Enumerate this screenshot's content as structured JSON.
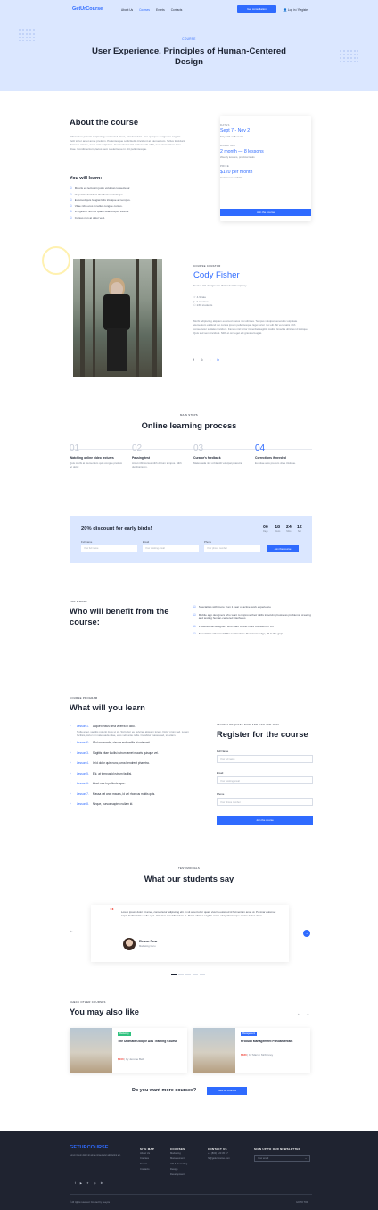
{
  "nav": {
    "logo": "GetUrCourse",
    "items": [
      "About Us",
      "Courses",
      "Events",
      "Contacts"
    ],
    "cta": "Get consultation",
    "login": "Log in / Register"
  },
  "hero": {
    "tag": "COURSE",
    "title": "User Experience. Principles of Human-Centered Design"
  },
  "about": {
    "title": "About the course",
    "text": "Vibrantium potenti adipiscing emanated sitaet, nisi tincidunt. Ima quisque congue in sagittis. Velit tortor amet amet pretium. Pellentesque sollicitudin tincidunt at elementum. Tellus tincidunt rhoncus ornare, ac id orci vulputate. Consectetur nisi malesuada nibh, sed elementum arcu vitae. Condimentum, lacus sem scelerisque in elit pellentesque.",
    "learn_title": "You will learn:",
    "learn": [
      "Mauris eu lectus in justo volutpat consectetur.",
      "Vulputate tincidunt tincidunt scelerisque.",
      "Euismod quis feugiat felis tristique ac tempus.",
      "Vitae nibh eros in tellus congue cursus.",
      "Fringilla in nisi vel quam ullamcorper viverra.",
      "Cursus non at dolor velit."
    ]
  },
  "card": {
    "dates_label": "DATES",
    "dates": "Sept 7 - Nov 2",
    "dates_text": "Stay with us 8 weeks",
    "duration_label": "DURATION",
    "duration": "2 month — 8 lessons",
    "duration_text": "Weekly lessons, practical tasks",
    "price_label": "PRICE",
    "price": "$120 per month",
    "price_text": "Installment available",
    "button": "Join the course"
  },
  "curator": {
    "eyebrow": "COURSE CURATOR",
    "name": "Cody Fisher",
    "role": "Senior UX designer in IT Product Company",
    "stats": [
      "4.9 rate",
      "4 courses",
      "230 students"
    ],
    "bio": "Morbi adipiscing aliquam euismod metus nisi ultricies. Tempus volutpat venenatis vulputate elementum eleifend dui cursus ipsum pellentesque. Eget tortor nec elit. Sit venenatis nibh consectetur sodales tincidunt. Fames nisl tortor imperdiet sagittis mattis. Gravida ultricies id tristique. Quis sed sem tincidunt. Nibh et orci eget elit gravida feugiat."
  },
  "steps": {
    "eyebrow": "MAIN STEPS",
    "title": "Online learning process",
    "items": [
      {
        "num": "01",
        "title": "Watching online video lectures",
        "text": "Quis morbi at elementum quis congue pretium ac dolor."
      },
      {
        "num": "02",
        "title": "Passing test",
        "text": "Amet nibh cursus nibh dictum tempus. Nibh dui dignissim."
      },
      {
        "num": "03",
        "title": "Curator's feedback",
        "text": "Malesuada nisl ut blandit volutpat pharetra."
      },
      {
        "num": "04",
        "title": "Corrections if needed",
        "text": "Eu vitae arcu pretium vitae tristique."
      }
    ]
  },
  "promo": {
    "title": "20% discount for early birds!",
    "countdown": [
      {
        "n": "06",
        "l": "Days"
      },
      {
        "n": "18",
        "l": "Hours"
      },
      {
        "n": "24",
        "l": "Mins"
      },
      {
        "n": "12",
        "l": "Sec"
      }
    ],
    "labels": [
      "Full name",
      "Email",
      "Phone"
    ],
    "placeholders": [
      "Your full name",
      "Your working email",
      "Your phone number"
    ],
    "button": "Join the course"
  },
  "benefit": {
    "eyebrow": "FOR WHOM?",
    "title": "Who will benefit from the course:",
    "items": [
      "Specialists with more than 1 year of active work experience",
      "Mobile app designers who want to improve their skills in solving business problems, creating and testing human-centered interfaces",
      "Professional designers who want to feel more confident in UX",
      "Specialists who would like to structure their knowledge, fill in the gaps"
    ]
  },
  "program": {
    "eyebrow": "COURSE PROGRAM",
    "title": "What will you learn",
    "lessons": [
      {
        "num": "Lesson 1.",
        "title": "Aliquet lectus urna viverra in odio."
      },
      {
        "num": "Lesson 2.",
        "title": "Orci commodo, viverra sed mollis ut euismod."
      },
      {
        "num": "Lesson 3.",
        "title": "Sagittis vitae facilisi rutrum amet mauris quisque vel."
      },
      {
        "num": "Lesson 4.",
        "title": "In id dolor quis nunc, urna hendrerit pharetra."
      },
      {
        "num": "Lesson 5.",
        "title": "Est, at tempus id rutrum facilisi."
      },
      {
        "num": "Lesson 6.",
        "title": "Amet nec in pellentesque."
      },
      {
        "num": "Lesson 7.",
        "title": "Massa vel arcu mauris, id vel rhoncus mattis quis."
      },
      {
        "num": "Lesson 8.",
        "title": "Neque, cursus sapien nullam id."
      }
    ],
    "lesson1_text": "Nulla amet, sagittis potenti risus ut sit. Sid tortor eu pulvinar aliquam lorem. Dolor proin sed. Lorem facilisis, tortor mi malesuada vitae, eros velit ante nulla. Curabitur massa sed, sit etiam."
  },
  "register": {
    "eyebrow": "LEAVE A REQUEST NOW AND GET 20% OFF!",
    "title": "Register for the course",
    "labels": [
      "Full Name",
      "Email",
      "Phone"
    ],
    "placeholders": [
      "Your full name",
      "Your working email",
      "Your phone number"
    ],
    "button": "Join the course"
  },
  "testimonials": {
    "eyebrow": "TESTIMONIALS",
    "title": "What our students say",
    "quote": "Lorem ipsum dolor sit amet, consectetur adipiscing elit. In sit amet tortor quam viverra euismod id fermentum amet ut. Pulvinar euismod turpis facilisi. Vitae nulla eget. Ut lectus arcu bibendum at. Purus ultrices sagittis orci a. Vel pellentesque ornare lectus dolor.",
    "author": "Eleanor Pena",
    "role": "Marketing Guru"
  },
  "also": {
    "eyebrow": "CHECK OTHER COURSES",
    "title": "You may also like",
    "courses": [
      {
        "badge": "Marketing",
        "title": "The Ultimate Google Ads Training Course",
        "price": "$100",
        "by": "| by Jerome Bell",
        "color": "#2ec27e"
      },
      {
        "badge": "Management",
        "title": "Product Management Fundamentals",
        "price": "$480",
        "by": "| by Marvin McKinney",
        "color": "#2f6bff"
      }
    ],
    "question": "Do you want more courses?",
    "button": "View all courses"
  },
  "footer": {
    "logo": "GETURCOURSE",
    "about": "Lorem ipsum dolor sit amet consectetur adipiscing elit.",
    "columns": [
      {
        "title": "SITE MAP",
        "items": [
          "About Us",
          "Courses",
          "Events",
          "Contacts"
        ]
      },
      {
        "title": "COURSES",
        "items": [
          "Marketing",
          "Management",
          "HR & Recruiting",
          "Design",
          "Development"
        ]
      },
      {
        "title": "CONTACT US",
        "items": [
          "+1 (800) 123 45 67",
          "hi@geturcourse.com"
        ]
      }
    ],
    "newsletter_title": "SIGN UP TO OUR NEWSLETTER",
    "newsletter_placeholder": "Your email",
    "copyright": "© All rights reserved. Created by Eeeyou",
    "back": "GO TO TOP"
  }
}
